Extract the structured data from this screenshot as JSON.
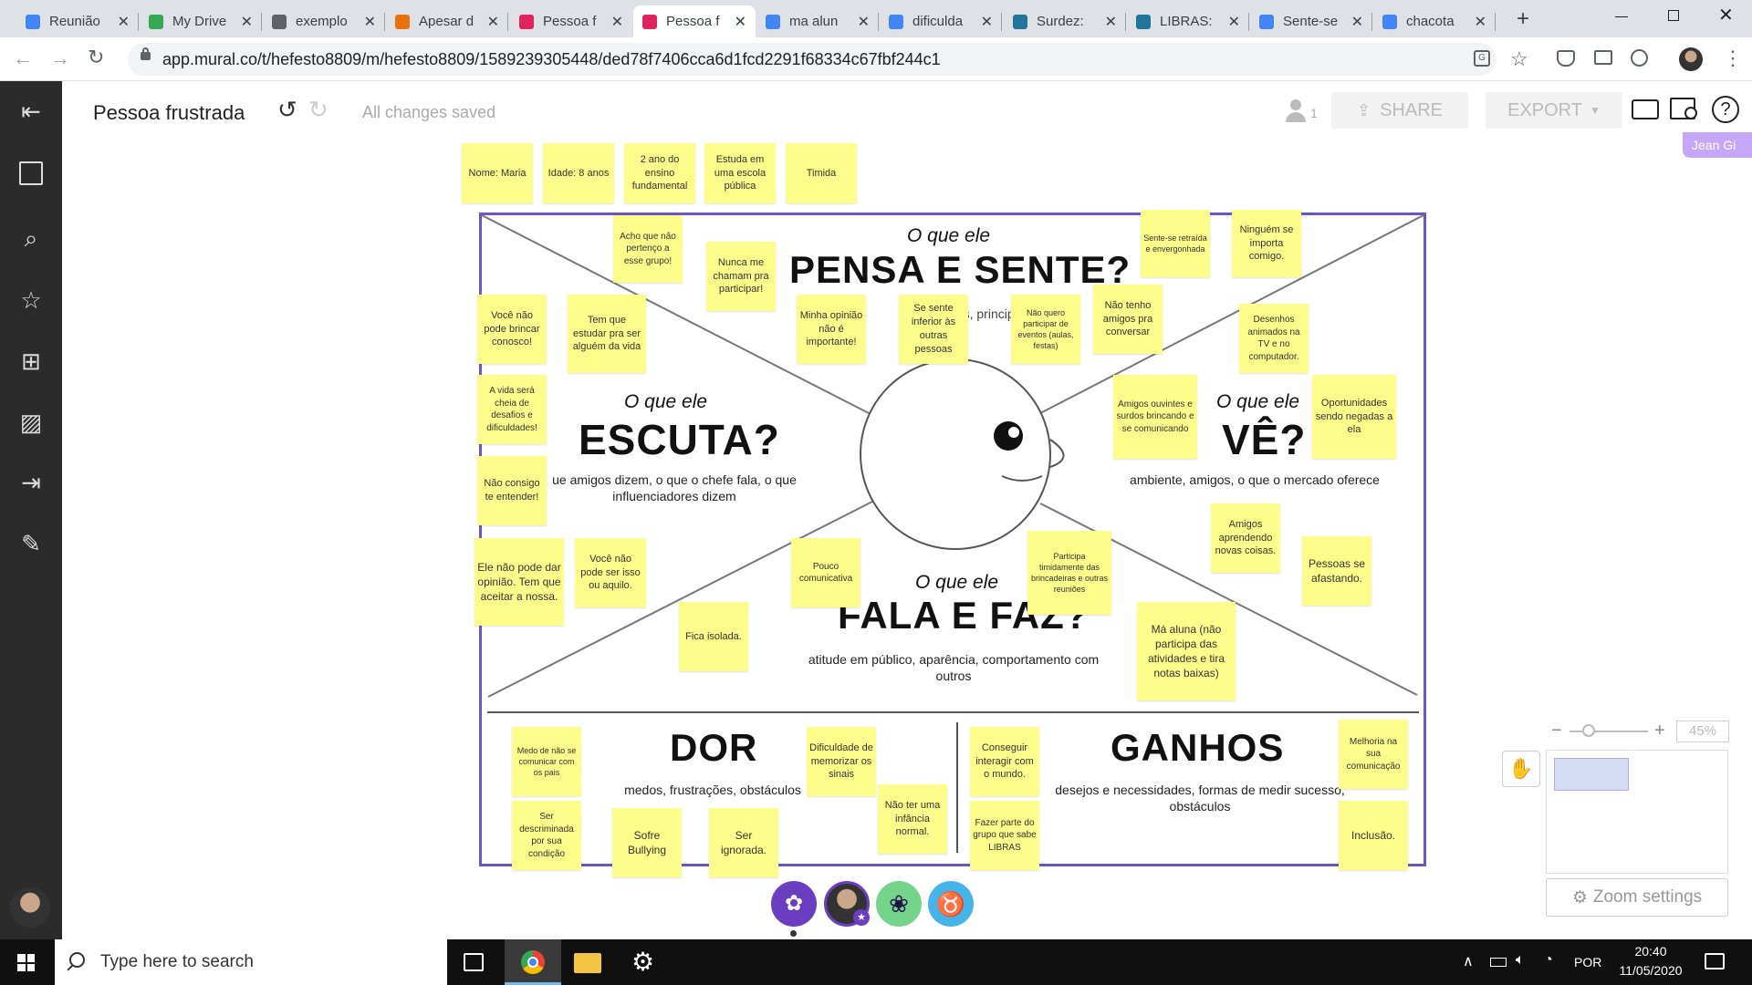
{
  "browser": {
    "tabs": [
      {
        "title": "Reunião",
        "icon": "docs-icon",
        "color": "#4285f4"
      },
      {
        "title": "My Drive",
        "icon": "drive-icon",
        "color": "#34a853"
      },
      {
        "title": "exemplo",
        "icon": "globe-icon",
        "color": "#5f6368"
      },
      {
        "title": "Apesar d",
        "icon": "shape-icon",
        "color": "#e8710a"
      },
      {
        "title": "Pessoa f",
        "icon": "mural-icon",
        "color": "#e0245e"
      },
      {
        "title": "Pessoa f",
        "icon": "mural-icon",
        "color": "#e0245e"
      },
      {
        "title": "ma alun",
        "icon": "google-icon",
        "color": "#4285f4"
      },
      {
        "title": "dificulda",
        "icon": "google-icon",
        "color": "#4285f4"
      },
      {
        "title": "Surdez:",
        "icon": "wordpress-icon",
        "color": "#21759b"
      },
      {
        "title": "LIBRAS:",
        "icon": "wordpress-icon",
        "color": "#21759b"
      },
      {
        "title": "Sente-se",
        "icon": "google-icon",
        "color": "#4285f4"
      },
      {
        "title": "chacota",
        "icon": "google-icon",
        "color": "#4285f4"
      }
    ],
    "url": "app.mural.co/t/hefesto8809/m/hefesto8809/1589239305448/ded78f7406cca6d1fcd2291f68334c67fbf244c1"
  },
  "header": {
    "title": "Pessoa frustrada",
    "saved": "All changes saved",
    "members": "1",
    "share": "SHARE",
    "export": "EXPORT"
  },
  "canvas": {
    "partial_label": "Jean Gi",
    "sections": {
      "pensa_q": "O que ele",
      "pensa": "PENSA E SENTE?",
      "pensa_sub": "sentimentos, principais p...",
      "escuta_q": "O que ele",
      "escuta": "ESCUTA?",
      "escuta_sub": "ue amigos dizem, o que o chefe fala, o que influenciadores dizem",
      "ve_q": "O que ele",
      "ve": "VÊ?",
      "ve_sub": "ambiente, amigos, o que o mercado oferece",
      "fala_q": "O que ele",
      "fala": "FALA E FAZ?",
      "fala_sub": "atitude em público, aparência, comportamento com outros",
      "dor": "DOR",
      "dor_sub": "medos, frustrações, obstáculos",
      "ganhos": "GANHOS",
      "ganhos_sub": "desejos e necessidades, formas de medir sucesso, obstáculos"
    },
    "stickies": [
      "Nome: Maria",
      "Idade: 8 anos",
      "2 ano do ensino fundamental",
      "Estuda em uma escola pública",
      "Timida",
      "Acho que não pertenço a esse grupo!",
      "Nunca me chamam pra participar!",
      "Sente-se retraída e envergonhada",
      "Ninguém se importa comigo.",
      "Você não pode brincar conosco!",
      "Tem que estudar pra ser alguém da vida",
      "Minha opinião não é importante!",
      "Se sente inferior às outras pessoas",
      "Não quero participar de eventos (aulas, festas)",
      "Não tenho amigos pra conversar",
      "Desenhos animados na TV e no computador.",
      "A vida será cheia de desafios e dificuldades!",
      "Amigos ouvintes e surdos brincando e se comunicando",
      "Oportunidades sendo negadas a ela",
      "Não consigo te entender!",
      "Amigos aprendendo novas coisas.",
      "Pessoas se afastando.",
      "Ele não pode dar opinião. Tem que aceitar a nossa.",
      "Você não pode ser isso ou aquilo.",
      "Pouco comunicativa",
      "Participa timidamente das brincadeiras e outras reuniões",
      "Fica isolada.",
      "Má aluna (não participa das atividades e tira notas baixas)",
      "Medo de não se comunicar com os pais",
      "Dificuldade de memorizar os sinais",
      "Conseguir interagir com o mundo.",
      "Melhoria na sua comunicação",
      "Ser descriminada por sua condição",
      "Sofre Bullying",
      "Ser ignorada.",
      "Não ter uma infância normal.",
      "Fazer parte do grupo que sabe LIBRAS",
      "Inclusão."
    ]
  },
  "zoom": {
    "value": "45%",
    "settings": "Zoom settings",
    "level": 0.45
  },
  "taskbar": {
    "search": "Type here to search",
    "lang": "POR",
    "time": "20:40",
    "date": "11/05/2020"
  }
}
